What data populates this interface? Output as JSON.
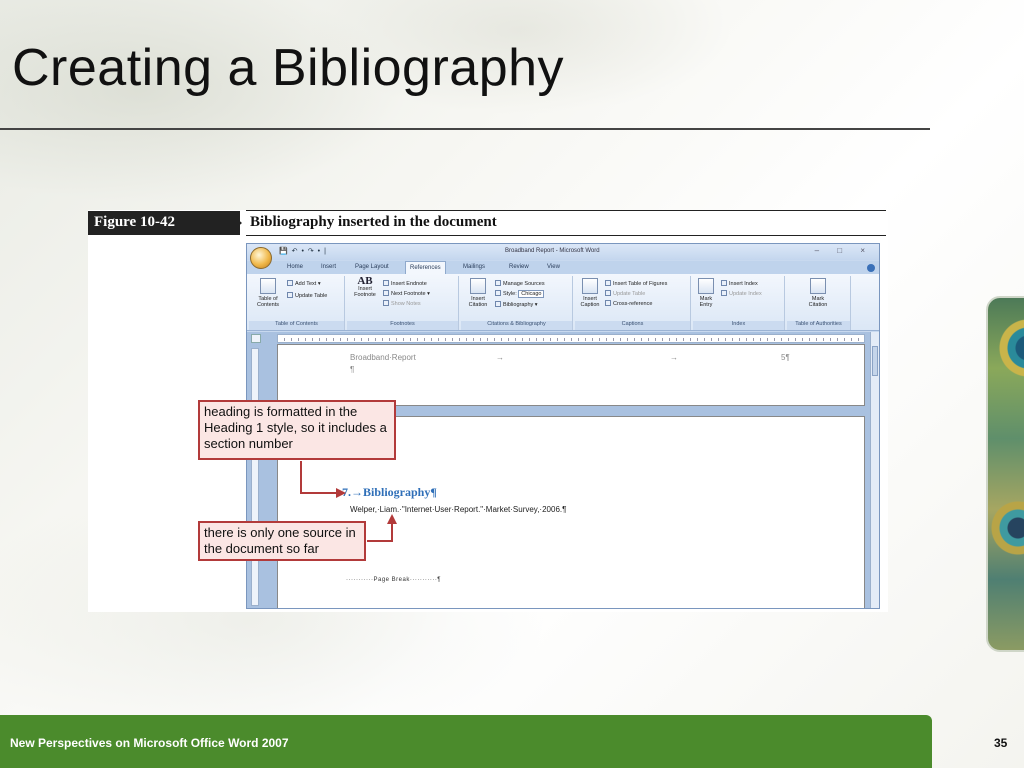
{
  "slide": {
    "title": "Creating a Bibliography",
    "footer": "New Perspectives on Microsoft Office Word 2007",
    "page_number": "35"
  },
  "figure": {
    "number": "Figure  10-42",
    "caption": "Bibliography inserted in the document"
  },
  "word": {
    "window_title": "Broadband Report - Microsoft Word",
    "quick_access": "💾 ↶ • ↷ • |",
    "window_controls": "– □ ×",
    "tabs": [
      "Home",
      "Insert",
      "Page Layout",
      "References",
      "Mailings",
      "Review",
      "View"
    ],
    "active_tab": "References",
    "ribbon": {
      "toc": {
        "table_of_contents": "Table of\nContents",
        "add_text": "Add Text",
        "update_table": "Update Table",
        "group": "Table of Contents"
      },
      "footnotes": {
        "ab": "AB",
        "insert_footnote": "Insert\nFootnote",
        "insert_endnote": "Insert Endnote",
        "next_footnote": "Next Footnote",
        "show_notes": "Show Notes",
        "group": "Footnotes"
      },
      "citations": {
        "insert_citation": "Insert\nCitation",
        "manage_sources": "Manage Sources",
        "style_label": "Style:",
        "style_value": "Chicago",
        "bibliography": "Bibliography",
        "group": "Citations & Bibliography"
      },
      "captions": {
        "insert_caption": "Insert\nCaption",
        "insert_table_of_figures": "Insert Table of Figures",
        "update_table": "Update Table",
        "cross_reference": "Cross-reference",
        "group": "Captions"
      },
      "index": {
        "mark_entry": "Mark\nEntry",
        "insert_index": "Insert Index",
        "update_index": "Update Index",
        "group": "Index"
      },
      "authorities": {
        "mark_citation": "Mark\nCitation",
        "group": "Table of Authorities"
      }
    },
    "document": {
      "header_text": "Broadband·Report",
      "header_tab1": "→",
      "header_tab2": "→",
      "header_page": "5¶",
      "header_pilcrow": "¶",
      "heading": "7.→Bibliography¶",
      "citation": "Welper,·Liam.·\"Internet·User·Report.\"·Market·Survey,·2006.¶",
      "page_break": "···········Page Break···········¶"
    }
  },
  "callouts": {
    "heading_note": "heading is formatted in the Heading 1 style, so it includes a section number",
    "source_note": "there is only one source in the document so far"
  },
  "colors": {
    "footer_green": "#4b8b2c",
    "callout_border": "#b23a3a",
    "heading_blue": "#2f6fb8"
  }
}
